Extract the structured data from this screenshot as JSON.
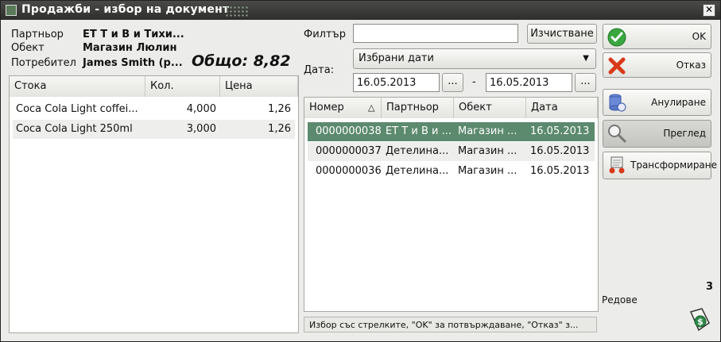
{
  "window": {
    "title": "Продажби - избор на документ"
  },
  "info": {
    "partner_label": "Партньор",
    "partner_value": "ЕТ Т и В и Тихи...",
    "object_label": "Обект",
    "object_value": "Магазин Люлин",
    "consumer_label": "Потребител",
    "consumer_value": "James Smith (р...",
    "total": "Общо:  8,82"
  },
  "items_table": {
    "columns": [
      "Стока",
      "Кол.",
      "Цена"
    ],
    "rows": [
      {
        "name": "Coca Cola Light coffei...",
        "qty": "4,000",
        "price": "1,26"
      },
      {
        "name": "Coca Cola Light 250ml",
        "qty": "3,000",
        "price": "1,26"
      }
    ]
  },
  "filter": {
    "label": "Филтър",
    "value": "",
    "clear_button": "Изчистване"
  },
  "date": {
    "label": "Дата:",
    "mode": "Избрани дати",
    "from": "16.05.2013",
    "to": "16.05.2013",
    "picker_label": "...",
    "separator": "-"
  },
  "docs_table": {
    "columns": [
      "Номер",
      "Партньор",
      "Обект",
      "Дата"
    ],
    "sort_indicator": "△",
    "rows": [
      {
        "number": "0000000038",
        "partner": "ЕТ Т и В и ...",
        "object": "Магазин ...",
        "date": "16.05.2013"
      },
      {
        "number": "0000000037",
        "partner": "Детелина...",
        "object": "Магазин ...",
        "date": "16.05.2013"
      },
      {
        "number": "0000000036",
        "partner": "Детелина...",
        "object": "Магазин ...",
        "date": "16.05.2013"
      }
    ]
  },
  "status_text": "Избор със стрелките, \"OK\" за потвърждаване, \"Отказ\" з...",
  "actions": {
    "ok": "OK",
    "cancel": "Отказ",
    "annul": "Анулиране",
    "preview": "Преглед",
    "transform": "Трансформиране"
  },
  "rows_count": "3",
  "rows_label": "Редове",
  "colors": {
    "selection": "#5c8a6e",
    "titlebar": "#3a3a38",
    "ok_check": "#3aa640",
    "cancel_x": "#d83a1a"
  }
}
